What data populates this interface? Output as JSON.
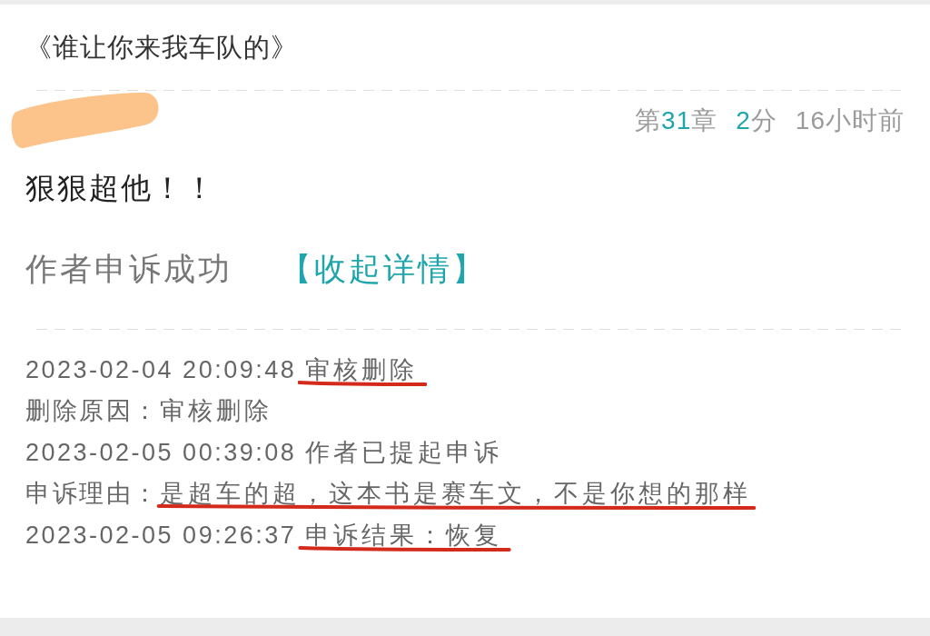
{
  "book_title": "《谁让你来我车队的》",
  "comment": {
    "user": {
      "redacted": true
    },
    "meta": [
      {
        "parts": [
          {
            "text": "第",
            "accent": false
          },
          {
            "text": "31",
            "accent": true
          },
          {
            "text": "章",
            "accent": false
          }
        ]
      },
      {
        "parts": [
          {
            "text": "2",
            "accent": true
          },
          {
            "text": "分",
            "accent": false
          }
        ]
      },
      {
        "parts": [
          {
            "text": "16小时前",
            "accent": false
          }
        ]
      }
    ],
    "text": "狠狠超他！！",
    "appeal": {
      "status": "作者申诉成功",
      "toggle": "【收起详情】"
    },
    "log": [
      {
        "prefix": "2023-02-04 20:09:48",
        "detail": "审核删除",
        "underlined": true
      },
      {
        "prefix": "删除原因：",
        "detail": "审核删除",
        "underlined": false
      },
      {
        "prefix": "2023-02-05 00:39:08",
        "detail": "作者已提起申诉",
        "underlined": false
      },
      {
        "prefix": "申诉理由：",
        "detail": "是超车的超，这本书是赛车文，不是你想的那样",
        "underlined": true
      },
      {
        "prefix": "2023-02-05 09:26:37",
        "detail": "申诉结果：恢复",
        "underlined": true
      }
    ]
  }
}
